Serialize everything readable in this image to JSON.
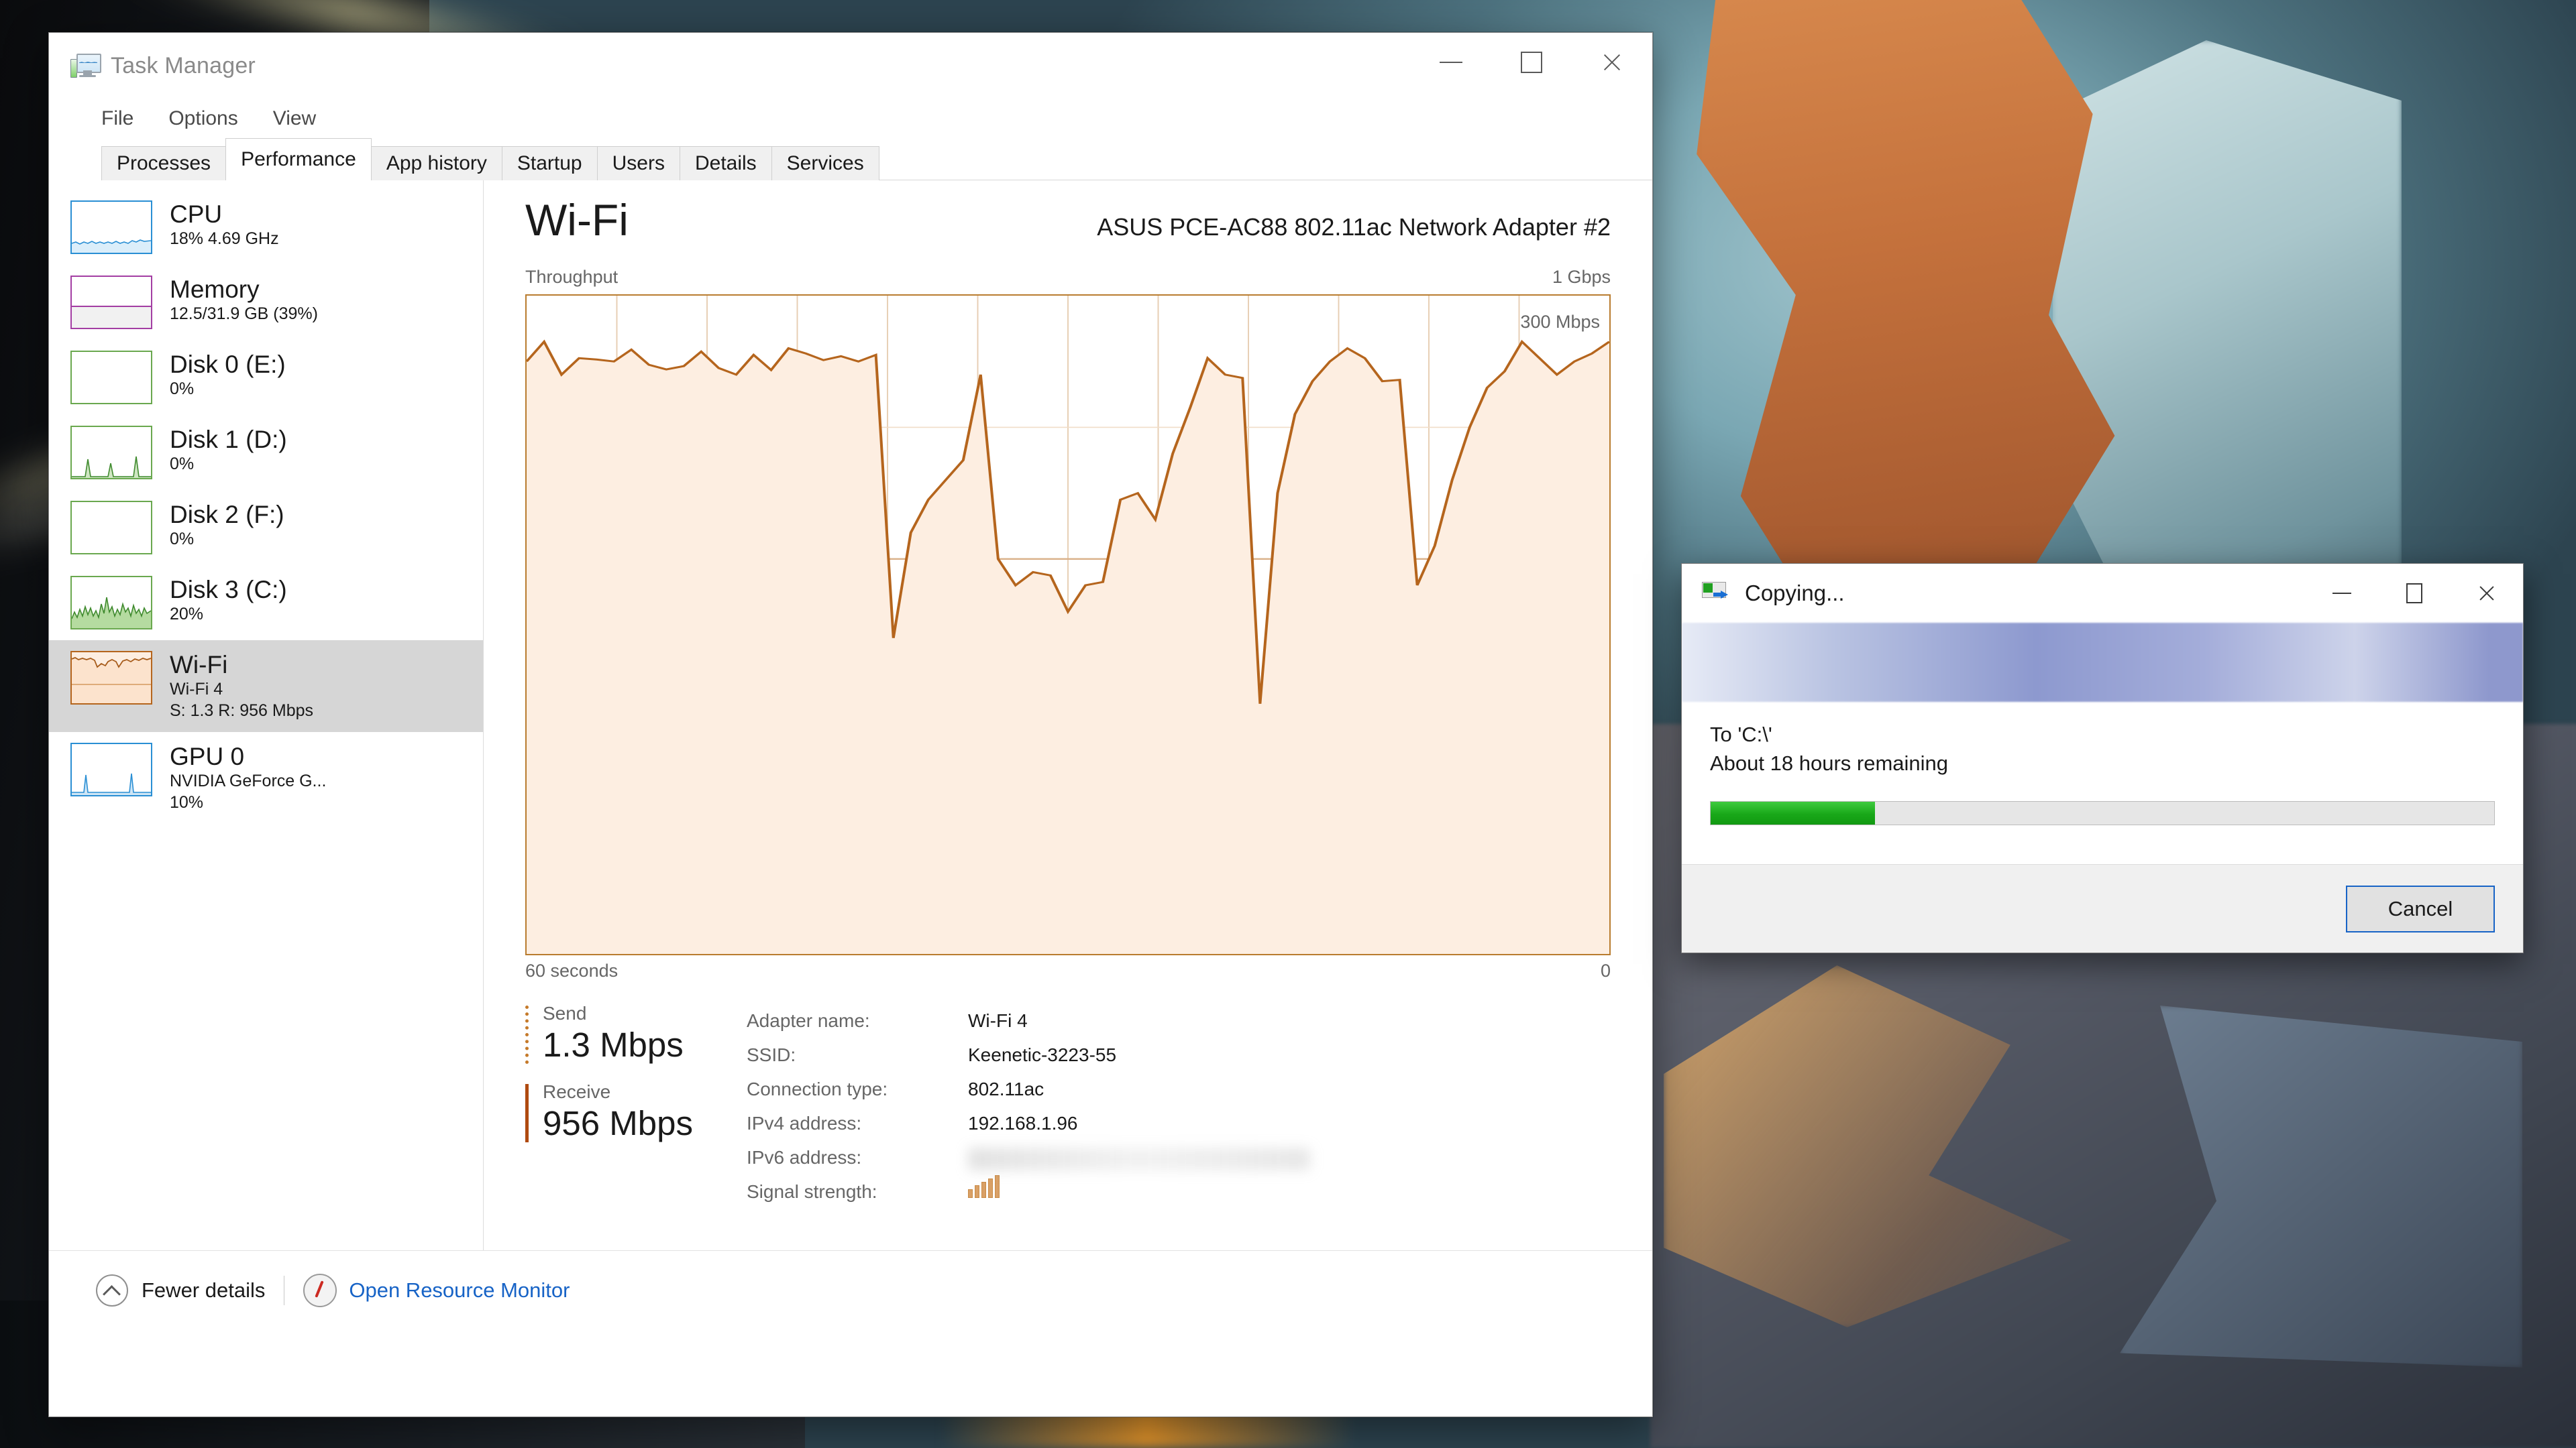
{
  "taskmanager": {
    "title": "Task Manager",
    "window_controls": {
      "minimize": "–",
      "maximize": "□",
      "close": "×"
    },
    "menus": [
      "File",
      "Options",
      "View"
    ],
    "tabs": [
      {
        "label": "Processes",
        "active": false
      },
      {
        "label": "Performance",
        "active": true
      },
      {
        "label": "App history",
        "active": false
      },
      {
        "label": "Startup",
        "active": false
      },
      {
        "label": "Users",
        "active": false
      },
      {
        "label": "Details",
        "active": false
      },
      {
        "label": "Services",
        "active": false
      }
    ],
    "sidebar": {
      "items": [
        {
          "name": "CPU",
          "sub1": "18%  4.69 GHz",
          "sub2": "",
          "color": "#2a8fd4",
          "selected": false
        },
        {
          "name": "Memory",
          "sub1": "12.5/31.9 GB (39%)",
          "sub2": "",
          "color": "#a33ea3",
          "selected": false
        },
        {
          "name": "Disk 0 (E:)",
          "sub1": "0%",
          "sub2": "",
          "color": "#3f8a2e",
          "selected": false
        },
        {
          "name": "Disk 1 (D:)",
          "sub1": "0%",
          "sub2": "",
          "color": "#3f8a2e",
          "selected": false
        },
        {
          "name": "Disk 2 (F:)",
          "sub1": "0%",
          "sub2": "",
          "color": "#3f8a2e",
          "selected": false
        },
        {
          "name": "Disk 3 (C:)",
          "sub1": "20%",
          "sub2": "",
          "color": "#3f8a2e",
          "selected": false
        },
        {
          "name": "Wi-Fi",
          "sub1": "Wi-Fi 4",
          "sub2": "S: 1.3 R: 956 Mbps",
          "color": "#b5651d",
          "selected": true
        },
        {
          "name": "GPU 0",
          "sub1": "NVIDIA GeForce G...",
          "sub2": "10%",
          "color": "#2a8fd4",
          "selected": false
        }
      ]
    },
    "detail": {
      "heading": "Wi-Fi",
      "adapter_model": "ASUS PCE-AC88 802.11ac Network Adapter #2",
      "graph_caption": "Throughput",
      "graph_max_label": "1 Gbps",
      "graph_mid_label": "300 Mbps",
      "graph_time_left": "60 seconds",
      "graph_time_right": "0",
      "send": {
        "label": "Send",
        "value": "1.3 Mbps"
      },
      "receive": {
        "label": "Receive",
        "value": "956 Mbps"
      },
      "fields": [
        {
          "key": "Adapter name:",
          "value": "Wi-Fi 4",
          "redacted": false
        },
        {
          "key": "SSID:",
          "value": "Keenetic-3223-55",
          "redacted": false
        },
        {
          "key": "Connection type:",
          "value": "802.11ac",
          "redacted": false
        },
        {
          "key": "IPv4 address:",
          "value": "192.168.1.96",
          "redacted": false
        },
        {
          "key": "IPv6 address:",
          "value": "",
          "redacted": true
        },
        {
          "key": "Signal strength:",
          "value": "",
          "redacted": false
        }
      ],
      "signal_strength_bars": 5
    },
    "footer": {
      "fewer_details": "Fewer details",
      "resource_monitor": "Open Resource Monitor"
    }
  },
  "copy_dialog": {
    "title": "Copying...",
    "window_controls": {
      "minimize": "–",
      "maximize": "□",
      "close": "×"
    },
    "destination": "To 'C:\\'",
    "time_remaining": "About 18 hours remaining",
    "progress_percent": 21,
    "cancel_label": "Cancel"
  },
  "colors": {
    "wifi_accent": "#b5651d",
    "wifi_fill": "#fdeee1",
    "progress_green": "#19a819",
    "link_blue": "#1763c6",
    "selection_gray": "#d6d6d6"
  },
  "chart_data": {
    "type": "area",
    "title": "Throughput",
    "ylabel": "",
    "xlabel": "",
    "ylim": [
      0,
      1000
    ],
    "yunit": "Mbps",
    "ytick_labels": [
      "1 Gbps",
      "300 Mbps",
      "0"
    ],
    "xtick_labels": [
      "60 seconds",
      "0"
    ],
    "grid": true,
    "series": [
      {
        "name": "Receive throughput",
        "color": "#b5651d",
        "values": [
          900,
          930,
          880,
          905,
          903,
          900,
          918,
          895,
          888,
          893,
          915,
          890,
          880,
          910,
          887,
          920,
          912,
          902,
          908,
          900,
          910,
          480,
          640,
          690,
          720,
          750,
          880,
          600,
          560,
          580,
          575,
          520,
          560,
          565,
          690,
          700,
          660,
          760,
          830,
          905,
          880,
          875,
          380,
          700,
          820,
          870,
          900,
          920,
          905,
          870,
          872,
          560,
          620,
          720,
          800,
          860,
          885,
          930,
          905,
          880,
          900,
          912,
          930
        ]
      }
    ]
  }
}
